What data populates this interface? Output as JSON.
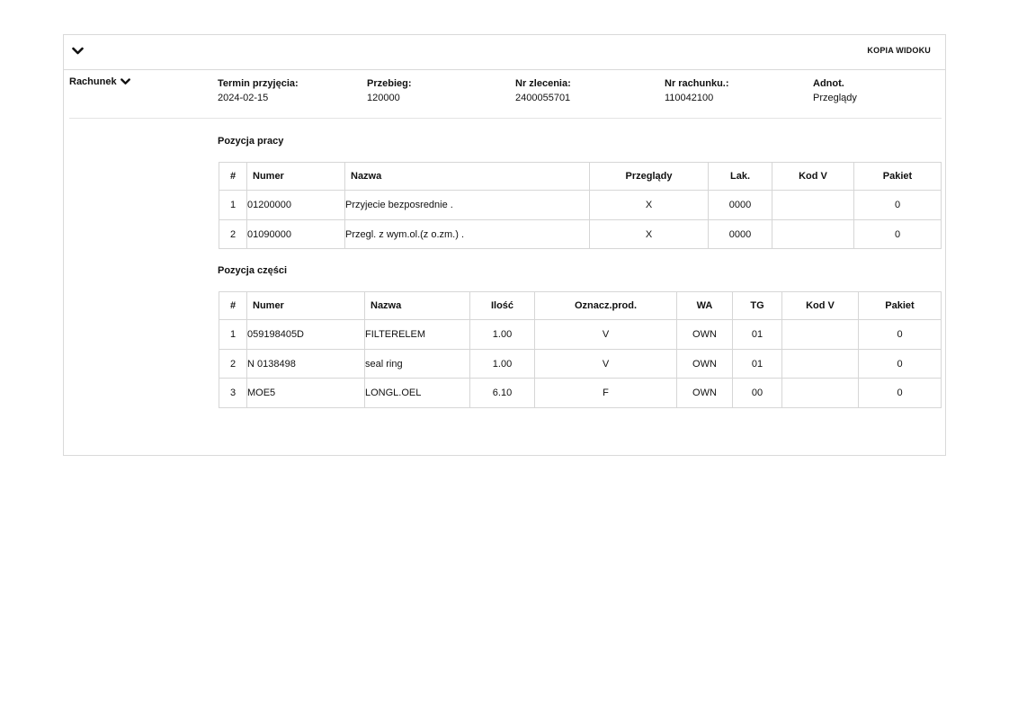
{
  "toolbar": {
    "copy_view_label": "KOPIA WIDOKU"
  },
  "section": {
    "title": "Rachunek"
  },
  "meta": [
    {
      "label": "Termin przyjęcia:",
      "value": "2024-02-15"
    },
    {
      "label": "Przebieg:",
      "value": "120000"
    },
    {
      "label": "Nr zlecenia:",
      "value": "2400055701"
    },
    {
      "label": "Nr rachunku.:",
      "value": "110042100"
    },
    {
      "label": "Adnot.",
      "value": "Przeglądy"
    }
  ],
  "work": {
    "title": "Pozycja pracy",
    "headers": [
      "#",
      "Numer",
      "Nazwa",
      "Przeglądy",
      "Lak.",
      "Kod V",
      "Pakiet"
    ],
    "rows": [
      [
        "1",
        "01200000",
        "Przyjecie bezposrednie .",
        "X",
        "0000",
        "",
        "0"
      ],
      [
        "2",
        "01090000",
        "Przegl. z wym.ol.(z o.zm.) .",
        "X",
        "0000",
        "",
        "0"
      ]
    ]
  },
  "parts": {
    "title": "Pozycja części",
    "headers": [
      "#",
      "Numer",
      "Nazwa",
      "Ilość",
      "Oznacz.prod.",
      "WA",
      "TG",
      "Kod V",
      "Pakiet"
    ],
    "rows": [
      [
        "1",
        "059198405D",
        "FILTERELEM",
        "1.00",
        "V",
        "OWN",
        "01",
        "",
        "0"
      ],
      [
        "2",
        "N 0138498",
        "seal ring",
        "1.00",
        "V",
        "OWN",
        "01",
        "",
        "0"
      ],
      [
        "3",
        "MOE5",
        "LONGL.OEL",
        "6.10",
        "F",
        "OWN",
        "00",
        "",
        "0"
      ]
    ]
  }
}
